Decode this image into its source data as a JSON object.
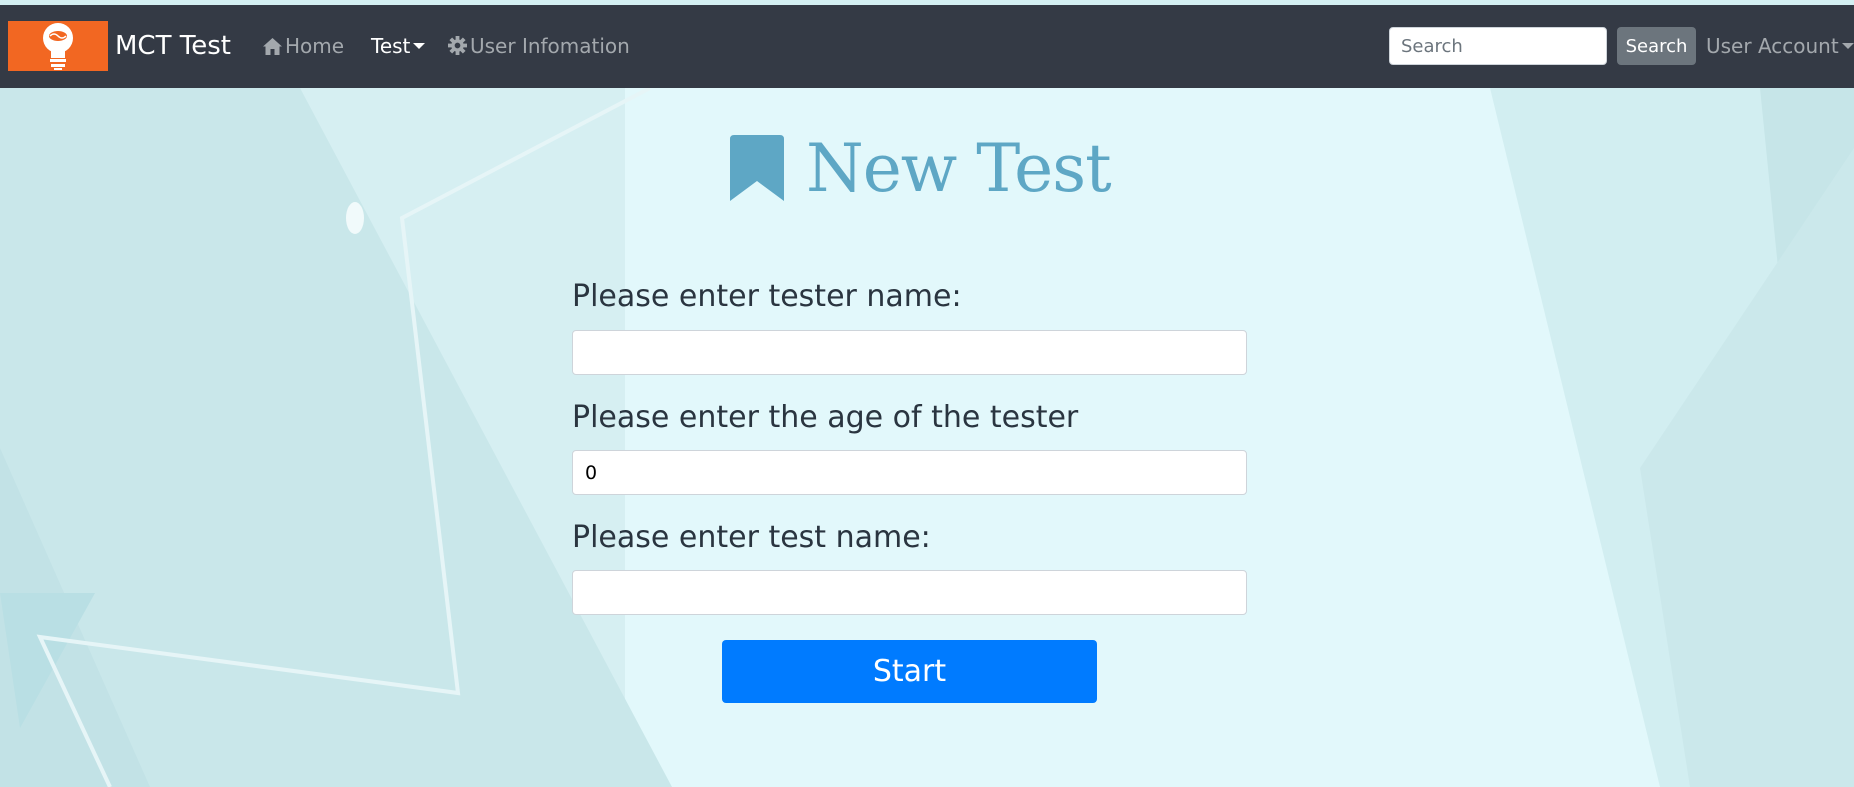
{
  "navbar": {
    "brand": "MCT Test",
    "home_label": "Home",
    "test_label": "Test",
    "user_info_label": "User Infomation",
    "search_placeholder": "Search",
    "search_button_label": "Search",
    "account_label": "User Account"
  },
  "main": {
    "heading": "New Test",
    "fields": [
      {
        "label": "Please enter tester name:",
        "value": ""
      },
      {
        "label": "Please enter the age of the tester",
        "value": "0"
      },
      {
        "label": "Please enter test name:",
        "value": ""
      }
    ],
    "start_label": "Start"
  },
  "colors": {
    "navbar_bg": "#343a45",
    "logo_bg": "#f26722",
    "heading": "#5ea7c5",
    "primary": "#007bff",
    "page_bg": "#e2f8fb"
  },
  "icons": [
    "lightbulb-icon",
    "home-icon",
    "gear-icon",
    "caret-down-icon",
    "bookmark-icon"
  ]
}
